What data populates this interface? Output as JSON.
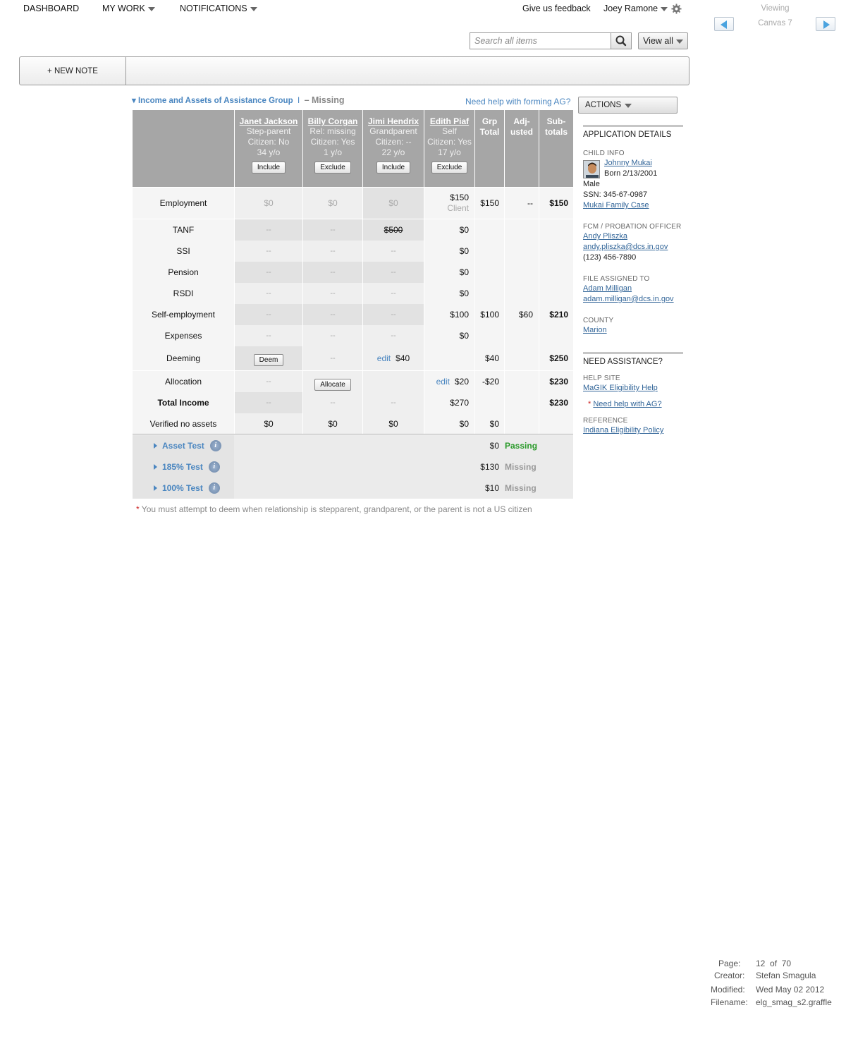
{
  "nav": {
    "dashboard": "DASHBOARD",
    "my_work": "MY WORK",
    "notifications": "NOTIFICATIONS",
    "feedback": "Give us feedback",
    "user": "Joey Ramone"
  },
  "viewing": {
    "label": "Viewing",
    "canvas": "Canvas 7"
  },
  "search": {
    "placeholder": "Search all items",
    "view_all": "View all"
  },
  "notes": {
    "new_note": "+ NEW NOTE"
  },
  "section": {
    "title": "Income and Assets of Assistance Group",
    "separator": "I",
    "status": "– Missing",
    "help_link": "Need help with forming AG?"
  },
  "people": [
    {
      "name": "Janet Jackson",
      "rel": "Step-parent",
      "citizen": "Citizen: No",
      "age": "34 y/o",
      "action": "Include"
    },
    {
      "name": "Billy Corgan",
      "rel": "Rel: missing",
      "citizen": "Citizen: Yes",
      "age": "1 y/o",
      "action": "Exclude"
    },
    {
      "name": "Jimi Hendrix",
      "rel": "Grandparent",
      "citizen": "Citizen: --",
      "age": "22 y/o",
      "action": "Include"
    },
    {
      "name": "Edith Piaf",
      "rel": "Self",
      "citizen": "Citizen: Yes",
      "age": "17 y/o",
      "action": "Exclude"
    }
  ],
  "columns": {
    "grp_total": [
      "Grp",
      "Total"
    ],
    "adjusted": [
      "Adj-",
      "usted"
    ],
    "subtotals": [
      "Sub-",
      "totals"
    ]
  },
  "rows": {
    "employment": {
      "label": "Employment",
      "janet": "$0",
      "billy": "$0",
      "jimi": "$0",
      "edith": "$150",
      "edith_note": "Client",
      "grp": "$150",
      "adj": "--",
      "sub": "$150"
    },
    "tanf": {
      "label": "TANF",
      "janet": "--",
      "billy": "--",
      "jimi": "$500",
      "edith": "$0"
    },
    "ssi": {
      "label": "SSI",
      "janet": "--",
      "billy": "--",
      "jimi": "--",
      "edith": "$0"
    },
    "pension": {
      "label": "Pension",
      "janet": "--",
      "billy": "--",
      "jimi": "--",
      "edith": "$0"
    },
    "rsdi": {
      "label": "RSDI",
      "janet": "--",
      "billy": "--",
      "jimi": "--",
      "edith": "$0"
    },
    "self_employment": {
      "label": "Self-employment",
      "janet": "--",
      "billy": "--",
      "jimi": "--",
      "edith": "$100",
      "grp": "$100",
      "adj": "$60",
      "sub": "$210"
    },
    "expenses": {
      "label": "Expenses",
      "janet": "--",
      "billy": "--",
      "jimi": "--",
      "edith": "$0"
    },
    "deeming": {
      "label": "Deeming",
      "janet_btn": "Deem",
      "billy": "--",
      "jimi_edit": "edit",
      "jimi": "$40",
      "grp": "$40",
      "sub": "$250"
    },
    "allocation": {
      "label": "Allocation",
      "janet": "--",
      "billy_btn": "Allocate",
      "edith_edit": "edit",
      "edith": "$20",
      "grp": "-$20",
      "sub": "$230"
    },
    "total_income": {
      "label": "Total Income",
      "janet": "--",
      "billy": "--",
      "jimi": "--",
      "edith": "$270",
      "sub": "$230"
    },
    "verified": {
      "label": "Verified no assets",
      "janet": "$0",
      "billy": "$0",
      "jimi": "$0",
      "edith": "$0",
      "grp": "$0"
    }
  },
  "tests": [
    {
      "label": "Asset Test",
      "value": "$0",
      "status": "Passing"
    },
    {
      "label": "185% Test",
      "value": "$130",
      "status": "Missing"
    },
    {
      "label": "100% Test",
      "value": "$10",
      "status": "Missing"
    }
  ],
  "footnote": {
    "star": "*",
    "text": "You must attempt to deem when relationship is stepparent, grandparent, or the parent is not a US citizen"
  },
  "sidebar": {
    "actions": "ACTIONS",
    "app_details": "APPLICATION DETAILS",
    "child_info": "CHILD INFO",
    "child_name": "Johnny Mukai",
    "born": "Born 2/13/2001",
    "gender": "Male",
    "ssn": "SSN: 345-67-0987",
    "family_case": "Mukai Family Case",
    "fcm": "FCM / PROBATION OFFICER",
    "fcm_name": "Andy Pliszka",
    "fcm_email": "andy.pliszka@dcs.in.gov",
    "fcm_phone": "(123) 456-7890",
    "assigned": "FILE ASSIGNED TO",
    "assigned_name": "Adam Milligan",
    "assigned_email": "adam.milligan@dcs.in.gov",
    "county": "COUNTY",
    "county_name": "Marion",
    "need_assist": "NEED ASSISTANCE?",
    "help_site": "HELP SITE",
    "help_site_link": "MaGIK Eligibility Help",
    "ag_star": "*",
    "ag_help": "Need help with AG?",
    "reference": "REFERENCE",
    "reference_link": "Indiana Eligibility Policy"
  },
  "page_info": {
    "page_label": "Page:",
    "page_num": "12",
    "of_label": "of",
    "page_total": "70",
    "creator_label": "Creator:",
    "creator": "Stefan Smagula",
    "modified_label": "Modified:",
    "modified": "Wed May 02 2012",
    "filename_label": "Filename:",
    "filename": "elg_smag_s2.graffle"
  }
}
